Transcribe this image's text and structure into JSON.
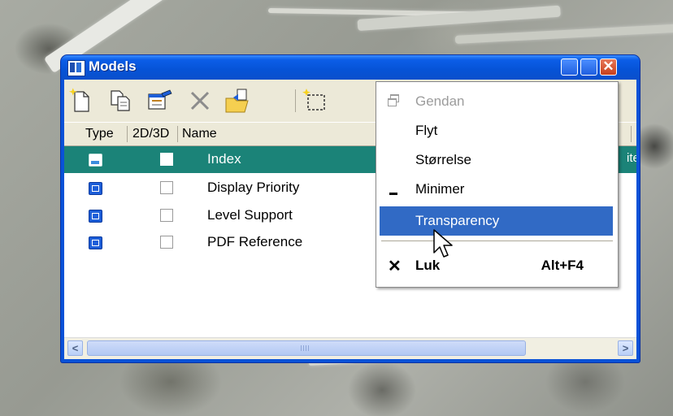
{
  "window": {
    "title": "Models",
    "icon": "microstation-app-icon",
    "close_glyph": "✕"
  },
  "toolbar": {
    "buttons": [
      {
        "name": "new-model-icon"
      },
      {
        "name": "copy-model-icon"
      },
      {
        "name": "edit-properties-icon"
      },
      {
        "name": "delete-icon"
      },
      {
        "name": "import-icon"
      },
      {
        "name": "select-area-icon"
      }
    ]
  },
  "columns": {
    "type": "Type",
    "dim": "2D/3D",
    "name": "Name"
  },
  "models": [
    {
      "type": "sheet",
      "name": "Index",
      "selected": true,
      "clipped": "ite"
    },
    {
      "type": "design",
      "name": "Display Priority",
      "selected": false
    },
    {
      "type": "design",
      "name": "Level Support",
      "selected": false
    },
    {
      "type": "design",
      "name": "PDF Reference",
      "selected": false
    }
  ],
  "scrollbar": {
    "left_arrow": "<",
    "right_arrow": ">"
  },
  "context_menu": {
    "restore": "Gendan",
    "move": "Flyt",
    "size": "Størrelse",
    "minimize": "Minimer",
    "transparency": "Transparency",
    "close": "Luk",
    "close_shortcut": "Alt+F4",
    "close_glyph": "✕"
  },
  "colors": {
    "titlebar": "#0653d6",
    "selected_row": "#1b8378",
    "menu_highlight": "#316ac5"
  }
}
